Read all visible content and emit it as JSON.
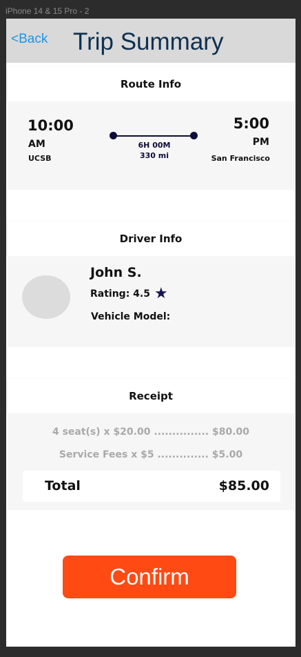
{
  "frame": {
    "label": "iPhone 14 & 15 Pro - 2"
  },
  "header": {
    "back_label": "<Back",
    "title": "Trip Summary"
  },
  "route": {
    "section_title": "Route Info",
    "depart_time": "10:00",
    "depart_period": "AM",
    "depart_place": "UCSB",
    "arrive_time": "5:00",
    "arrive_period": "PM",
    "arrive_place": "San Francisco",
    "duration": "6H 00M",
    "distance": "330 mi"
  },
  "driver": {
    "section_title": "Driver Info",
    "name": "John S.",
    "rating_label": "Rating: 4.5",
    "vehicle_label": "Vehicle Model:"
  },
  "receipt": {
    "section_title": "Receipt",
    "seat_line": "4 seat(s) x $20.00 ............... $80.00",
    "fee_line": "Service Fees x $5 .............. $5.00",
    "total_label": "Total",
    "total_value": "$85.00"
  },
  "confirm_label": "Confirm",
  "colors": {
    "header_bg": "#d9d9d9",
    "title": "#0e3050",
    "back_link": "#1a96e6",
    "confirm_bg": "#ff4a14",
    "route_line": "#0d0d3a"
  },
  "icons": {
    "rating": "star-icon"
  }
}
